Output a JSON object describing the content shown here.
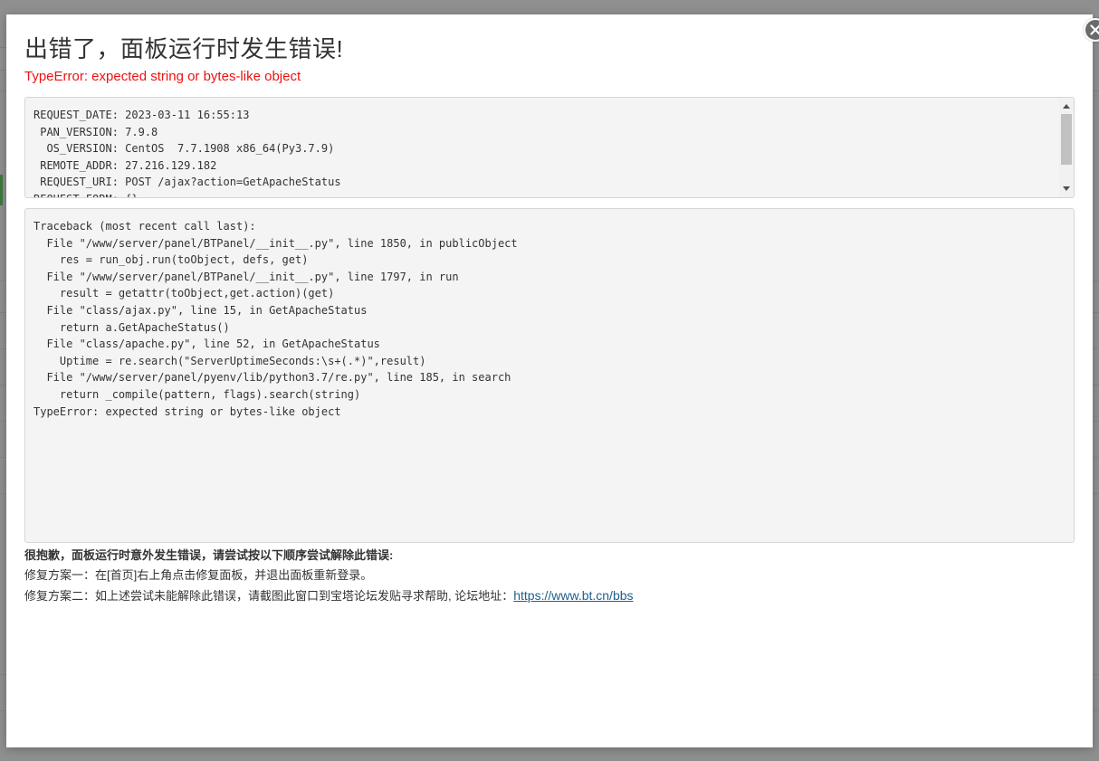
{
  "dialog": {
    "title": "出错了，面板运行时发生错误!",
    "error_summary": "TypeError: expected string or bytes-like object",
    "close_icon": "close-icon"
  },
  "request_info": [
    "REQUEST_DATE: 2023-03-11 16:55:13",
    " PAN_VERSION: 7.9.8",
    "  OS_VERSION: CentOS  7.7.1908 x86_64(Py3.7.9)",
    " REMOTE_ADDR: 27.216.129.182",
    " REQUEST_URI: POST /ajax?action=GetApacheStatus",
    "REQUEST_FORM: {}"
  ],
  "traceback": [
    "Traceback (most recent call last):",
    "  File \"/www/server/panel/BTPanel/__init__.py\", line 1850, in publicObject",
    "    res = run_obj.run(toObject, defs, get)",
    "  File \"/www/server/panel/BTPanel/__init__.py\", line 1797, in run",
    "    result = getattr(toObject,get.action)(get)",
    "  File \"class/ajax.py\", line 15, in GetApacheStatus",
    "    return a.GetApacheStatus()",
    "  File \"class/apache.py\", line 52, in GetApacheStatus",
    "    Uptime = re.search(\"ServerUptimeSeconds:\\s+(.*)\",result)",
    "  File \"/www/server/panel/pyenv/lib/python3.7/re.py\", line 185, in search",
    "    return _compile(pattern, flags).search(string)",
    "TypeError: expected string or bytes-like object"
  ],
  "help": {
    "title": "很抱歉，面板运行时意外发生错误，请尝试按以下顺序尝试解除此错误:",
    "option1": "修复方案一：在[首页]右上角点击修复面板，并退出面板重新登录。",
    "option2_prefix": "修复方案二：如上述尝试未能解除此错误，请截图此窗口到宝塔论坛发贴寻求帮助, 论坛地址：",
    "forum_link": "https://www.bt.cn/bbs"
  },
  "colors": {
    "error_red": "#ee1111",
    "link_blue": "#20608e",
    "box_bg": "#f4f4f4"
  }
}
